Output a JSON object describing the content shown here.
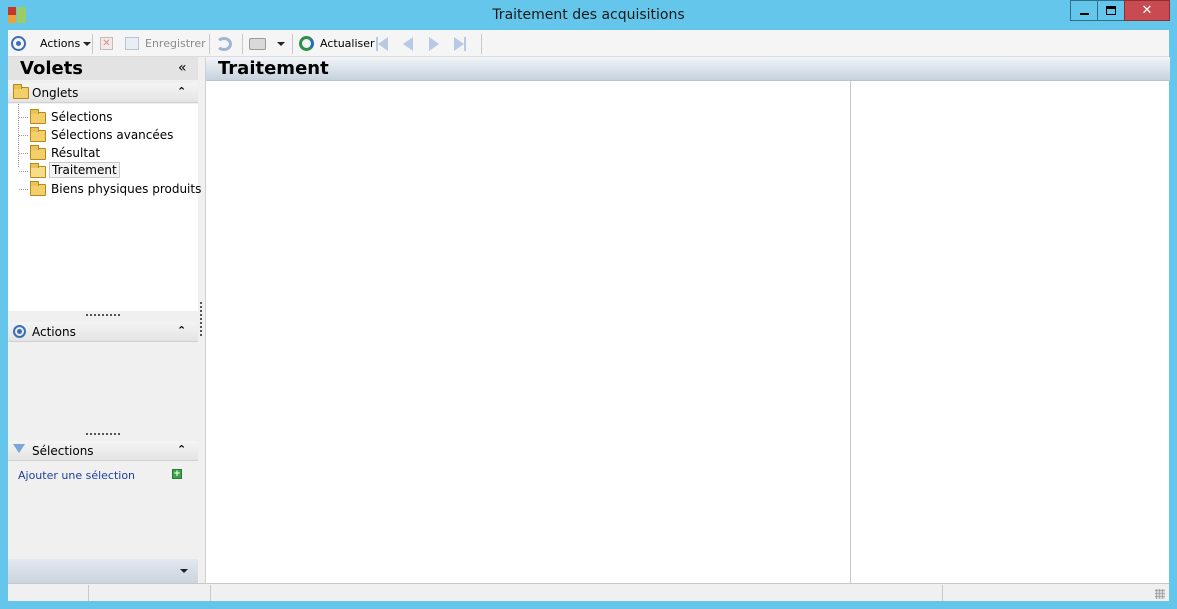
{
  "window": {
    "title": "Traitement des acquisitions",
    "close_glyph": "✕"
  },
  "toolbar": {
    "actions_label": "Actions",
    "save_label": "Enregistrer",
    "refresh_label": "Actualiser",
    "icons": [
      "actions-icon",
      "delete-icon",
      "save-icon",
      "sync-icon",
      "print-icon",
      "refresh-icon",
      "first-record-icon",
      "previous-record-icon",
      "next-record-icon",
      "last-record-icon"
    ]
  },
  "left_panel": {
    "title": "Volets",
    "collapse_glyph": "«",
    "tabs_section": {
      "label": "Onglets",
      "chevron": "⌃",
      "items": [
        {
          "label": "Sélections",
          "selected": false
        },
        {
          "label": "Sélections avancées",
          "selected": false
        },
        {
          "label": "Résultat",
          "selected": false
        },
        {
          "label": "Traitement",
          "selected": true
        },
        {
          "label": "Biens physiques produits",
          "selected": false
        }
      ]
    },
    "actions_section": {
      "label": "Actions",
      "chevron": "⌃"
    },
    "selections_section": {
      "label": "Sélections",
      "chevron": "⌃",
      "add_link": "Ajouter une sélection",
      "add_glyph": "+"
    }
  },
  "main": {
    "title": "Traitement"
  },
  "colors": {
    "window_frame": "#63c6ea",
    "close_button": "#c74b50",
    "link": "#1f3f9f",
    "folder": "#f2cf6b"
  }
}
